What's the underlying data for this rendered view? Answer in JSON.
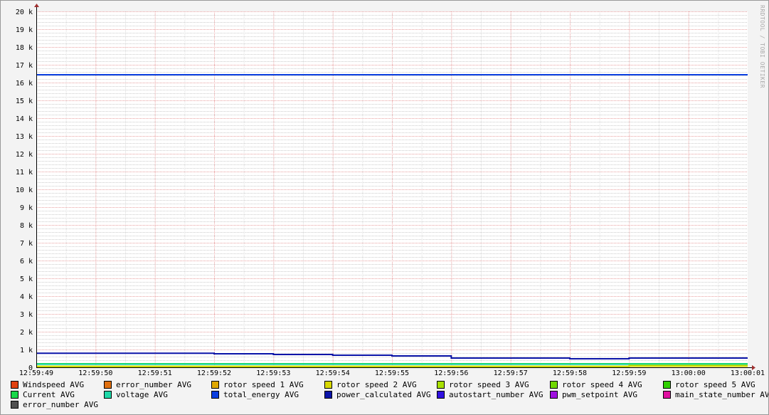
{
  "chart_data": {
    "type": "line",
    "title": "",
    "xlabel": "",
    "ylabel": "",
    "ylim": [
      0,
      20000
    ],
    "y_ticks": [
      "0",
      "1 k",
      "2 k",
      "3 k",
      "4 k",
      "5 k",
      "6 k",
      "7 k",
      "8 k",
      "9 k",
      "10 k",
      "11 k",
      "12 k",
      "13 k",
      "14 k",
      "15 k",
      "16 k",
      "17 k",
      "18 k",
      "19 k",
      "20 k"
    ],
    "x_ticks": [
      "12:59:49",
      "12:59:50",
      "12:59:51",
      "12:59:52",
      "12:59:53",
      "12:59:54",
      "12:59:55",
      "12:59:56",
      "12:59:57",
      "12:59:58",
      "12:59:59",
      "13:00:00",
      "13:00:01"
    ],
    "x_seconds": [
      0,
      1,
      2,
      3,
      4,
      5,
      6,
      7,
      8,
      9,
      10,
      11,
      12
    ],
    "grid": true,
    "legend_placement": "bottom",
    "series": [
      {
        "name": "total_energy AVG",
        "color": "#0a3ee0",
        "step": [
          [
            0,
            16440
          ],
          [
            12,
            16440
          ]
        ]
      },
      {
        "name": "power_calculated AVG",
        "color": "#0a14a8",
        "step": [
          [
            0,
            790
          ],
          [
            3,
            760
          ],
          [
            4,
            720
          ],
          [
            5,
            680
          ],
          [
            6,
            640
          ],
          [
            7,
            520
          ],
          [
            9,
            480
          ],
          [
            10,
            520
          ],
          [
            12,
            520
          ]
        ]
      },
      {
        "name": "Current AVG",
        "color": "#18d848",
        "step": [
          [
            0,
            200
          ],
          [
            12,
            200
          ]
        ]
      },
      {
        "name": "voltage AVG",
        "color": "#1ed8a8",
        "step": [
          [
            0,
            170
          ],
          [
            12,
            170
          ]
        ]
      },
      {
        "name": "rotor speed 3 AVG",
        "color": "#a8e000",
        "step": [
          [
            0,
            0
          ],
          [
            10,
            0
          ],
          [
            10,
            110
          ],
          [
            12,
            110
          ]
        ]
      },
      {
        "name": "rotor speed 2 AVG",
        "color": "#d8d800",
        "step": [
          [
            0,
            60
          ],
          [
            12,
            60
          ]
        ]
      }
    ]
  },
  "legend": [
    {
      "label": "Windspeed AVG",
      "color": "#e04010"
    },
    {
      "label": "error_number AVG",
      "color": "#e07010"
    },
    {
      "label": "rotor speed 1 AVG",
      "color": "#e0a800"
    },
    {
      "label": "rotor speed 2 AVG",
      "color": "#d8d800"
    },
    {
      "label": "rotor speed 3 AVG",
      "color": "#a8e000"
    },
    {
      "label": "rotor speed 4 AVG",
      "color": "#70d800"
    },
    {
      "label": "rotor speed 5 AVG",
      "color": "#30d000"
    },
    {
      "label": "Current AVG",
      "color": "#18d848"
    },
    {
      "label": "voltage AVG",
      "color": "#1ed8a8"
    },
    {
      "label": "total_energy AVG",
      "color": "#0a3ee0"
    },
    {
      "label": "power_calculated AVG",
      "color": "#0a14a8"
    },
    {
      "label": "autostart_number AVG",
      "color": "#3010e0"
    },
    {
      "label": "pwm_setpoint AVG",
      "color": "#a010e0"
    },
    {
      "label": "main_state_number AVG",
      "color": "#e010a0"
    },
    {
      "label": "error_number AVG",
      "color": "#505050"
    }
  ],
  "watermark": "RRDTOOL / TOBI OETIKER"
}
